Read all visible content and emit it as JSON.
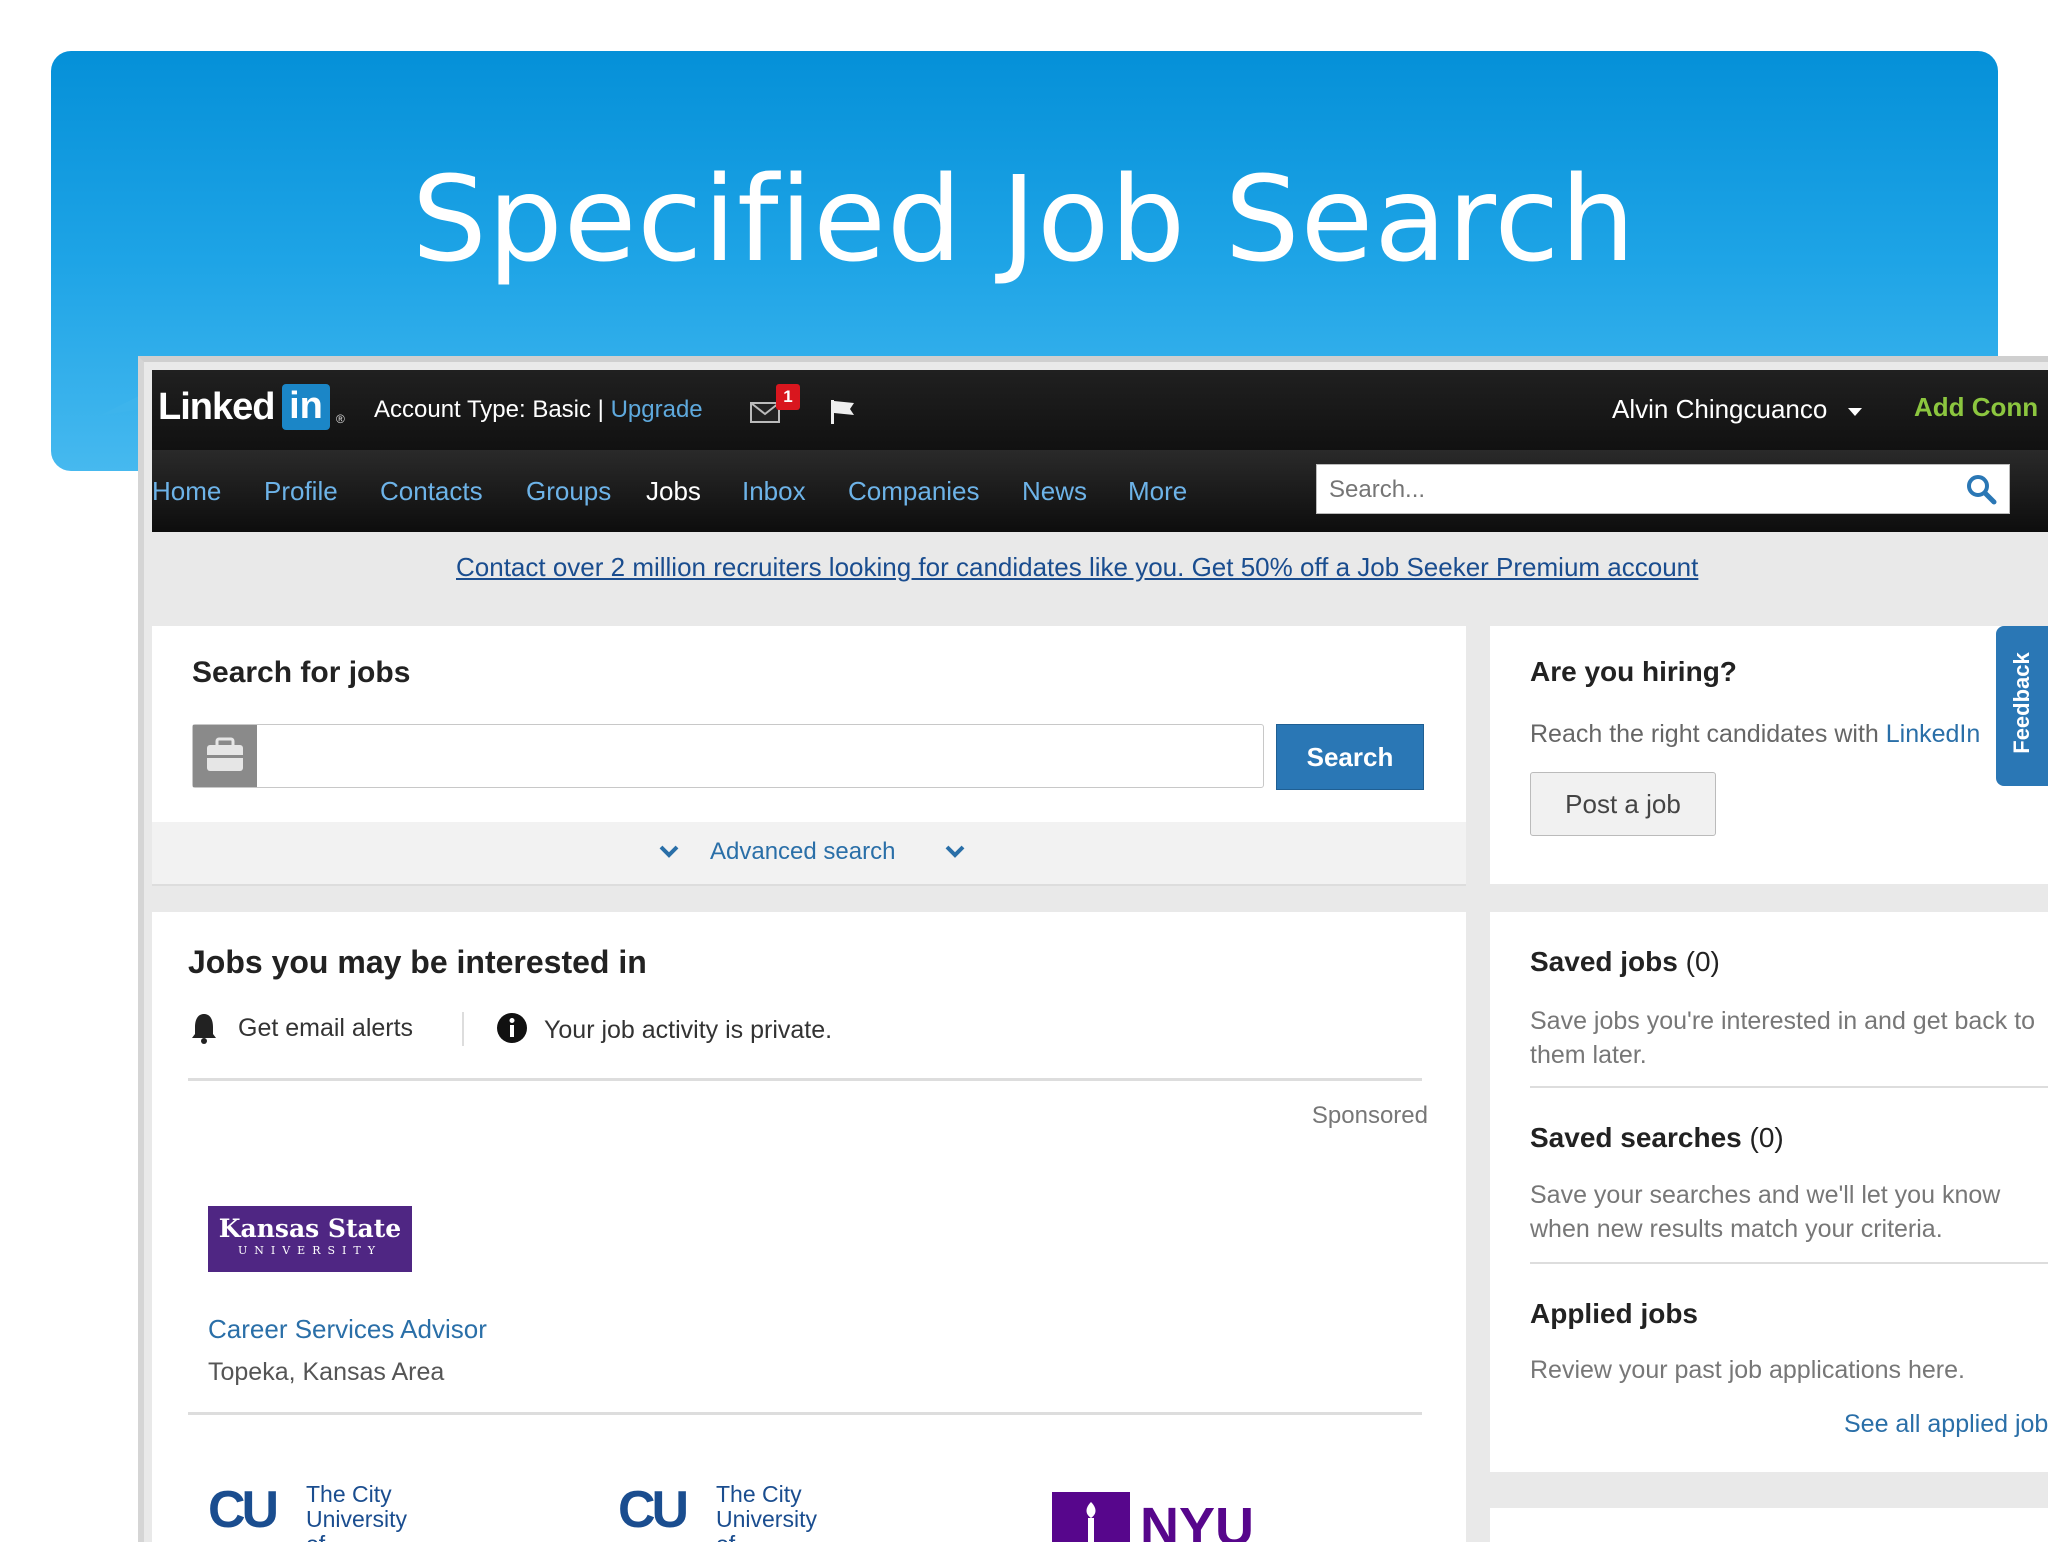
{
  "slide": {
    "title": "Specified Job Search"
  },
  "topbar": {
    "logo_text": "Linked",
    "logo_in": "in",
    "logo_reg": "®",
    "account_prefix": "Account Type: Basic | ",
    "upgrade": "Upgrade",
    "mail_badge": "1",
    "user_name": "Alvin Chingcuanco",
    "add_connections": "Add Conn"
  },
  "nav": {
    "items": [
      "Home",
      "Profile",
      "Contacts",
      "Groups",
      "Jobs",
      "Inbox",
      "Companies",
      "News",
      "More"
    ],
    "active": "Jobs",
    "search_placeholder": "Search..."
  },
  "promo": {
    "text": "Contact over 2 million recruiters looking for candidates like you. Get 50% off a Job Seeker Premium account"
  },
  "search_jobs": {
    "title": "Search for jobs",
    "input_value": "",
    "button": "Search",
    "advanced": "Advanced search"
  },
  "jobs": {
    "title": "Jobs you may be interested in",
    "email_alerts": "Get email alerts",
    "privacy": "Your job activity is private.",
    "sponsored": "Sponsored",
    "featured": {
      "company_logo_line1": "Kansas State",
      "company_logo_line2": "UNIVERSITY",
      "title": "Career Services Advisor",
      "location": "Topeka, Kansas Area"
    },
    "more_logos": [
      {
        "mark": "CU",
        "text_lines": [
          "The City",
          "University",
          "of"
        ]
      },
      {
        "mark": "CU",
        "text_lines": [
          "The City",
          "University",
          "of"
        ]
      },
      {
        "mark": "NYU"
      }
    ]
  },
  "hiring": {
    "title": "Are you hiring?",
    "text": "Reach the right candidates with ",
    "link": "LinkedIn",
    "button": "Post a job"
  },
  "saved": {
    "saved_jobs_title": "Saved jobs",
    "saved_jobs_count": "(0)",
    "saved_jobs_text": "Save jobs you're interested in and get back to them later.",
    "saved_searches_title": "Saved searches",
    "saved_searches_count": "(0)",
    "saved_searches_text": "Save your searches and we'll let you know when new results match your criteria.",
    "applied_title": "Applied jobs",
    "applied_text": "Review your past job applications here.",
    "see_all": "See all applied jobs"
  },
  "feedback": {
    "label": "Feedback"
  },
  "colors": {
    "brand": "#1b86c7",
    "link": "#2a6fa8",
    "nav_link": "#6db3e8",
    "add_conn": "#8cc63f"
  }
}
